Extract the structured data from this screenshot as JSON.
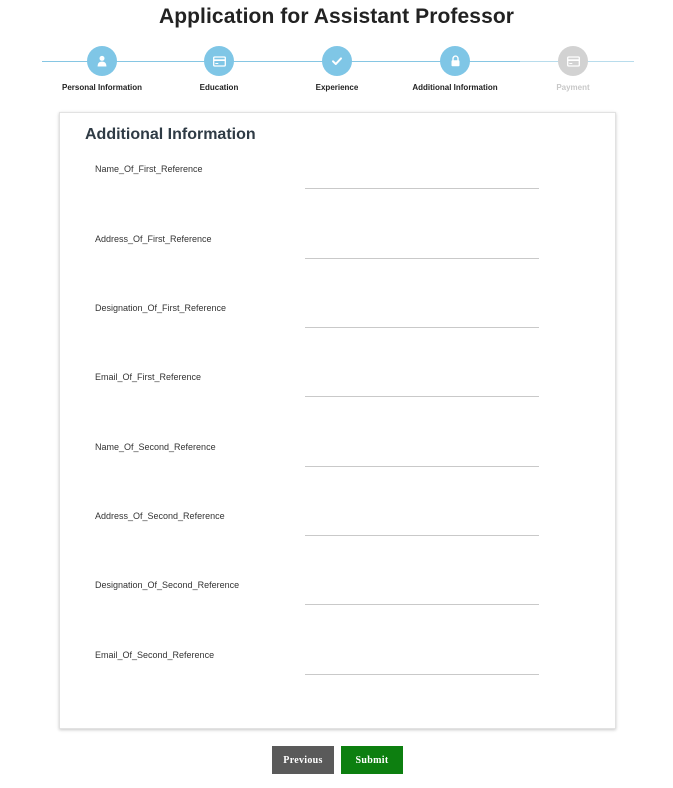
{
  "page": {
    "title": "Application for Assistant Professor"
  },
  "steps": [
    {
      "label": "Personal Information",
      "icon": "user-icon",
      "active": true
    },
    {
      "label": "Education",
      "icon": "card-icon",
      "active": true
    },
    {
      "label": "Experience",
      "icon": "check-icon",
      "active": true
    },
    {
      "label": "Additional Information",
      "icon": "lock-icon",
      "active": true
    },
    {
      "label": "Payment",
      "icon": "card-icon",
      "active": false
    }
  ],
  "form": {
    "section_title": "Additional Information",
    "fields": [
      {
        "label": "Name_Of_First_Reference",
        "value": ""
      },
      {
        "label": "Address_Of_First_Reference",
        "value": ""
      },
      {
        "label": "Designation_Of_First_Reference",
        "value": ""
      },
      {
        "label": "Email_Of_First_Reference",
        "value": ""
      },
      {
        "label": "Name_Of_Second_Reference",
        "value": ""
      },
      {
        "label": "Address_Of_Second_Reference",
        "value": ""
      },
      {
        "label": "Designation_Of_Second_Reference",
        "value": ""
      },
      {
        "label": "Email_Of_Second_Reference",
        "value": ""
      }
    ]
  },
  "buttons": {
    "previous": "Previous",
    "submit": "Submit"
  },
  "colors": {
    "step_active": "#7fc6e6",
    "step_inactive": "#d2d2d2",
    "previous_button": "#5a5a5a",
    "submit_button": "#0d7f10"
  }
}
